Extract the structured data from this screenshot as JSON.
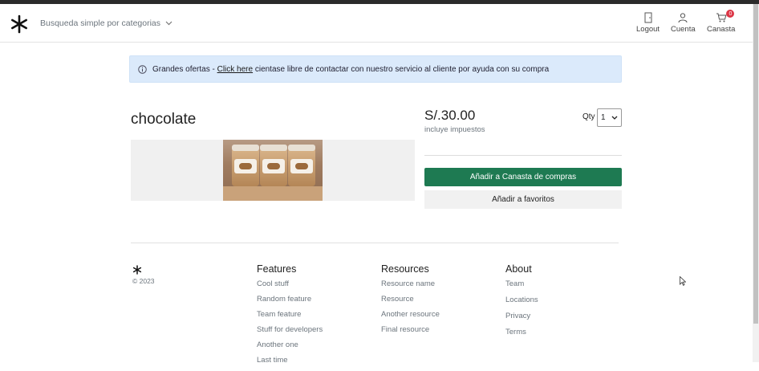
{
  "nav": {
    "search_category_label": "Busqueda simple por categorias",
    "logout_label": "Logout",
    "account_label": "Cuenta",
    "cart_label": "Canasta",
    "cart_count": "0"
  },
  "alert": {
    "prefix": "Grandes ofertas - ",
    "link_text": "Click here",
    "suffix": " cientase libre de contactar con nuestro servicio al cliente por ayuda con su compra"
  },
  "product": {
    "title": "chocolate",
    "price": "S/.30.00",
    "tax_note": "incluye impuestos",
    "qty_label": "Qty",
    "qty_value": "1",
    "add_to_cart_label": "Añadir a Canasta de compras",
    "add_to_favorites_label": "Añadir a favoritos"
  },
  "footer": {
    "copyright": "© 2023",
    "columns": [
      {
        "title": "Features",
        "items": [
          "Cool stuff",
          "Random feature",
          "Team feature",
          "Stuff for developers",
          "Another one",
          "Last time"
        ]
      },
      {
        "title": "Resources",
        "items": [
          "Resource name",
          "Resource",
          "Another resource",
          "Final resource"
        ]
      },
      {
        "title": "About",
        "items": [
          "Team",
          "Locations",
          "Privacy",
          "Terms"
        ]
      }
    ]
  },
  "colors": {
    "primary_button": "#1e7a52",
    "alert_background": "#dbeafb",
    "cart_badge": "#dc3545"
  }
}
